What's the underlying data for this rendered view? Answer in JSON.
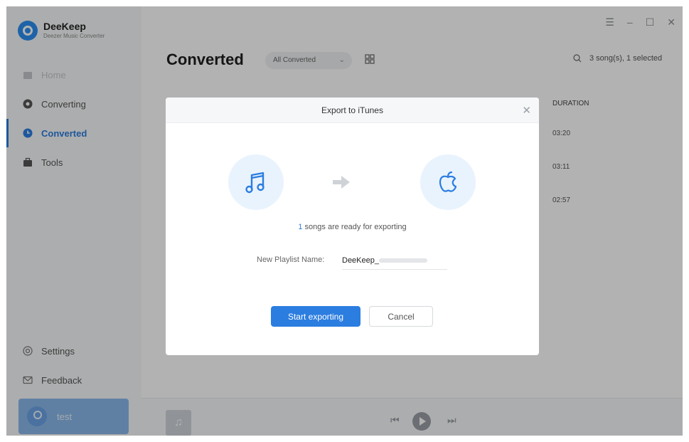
{
  "app": {
    "name": "DeeKeep",
    "subtitle": "Deezer Music Converter"
  },
  "sidebar": {
    "items": [
      {
        "label": "Home",
        "icon": "home-icon"
      },
      {
        "label": "Converting",
        "icon": "converting-icon"
      },
      {
        "label": "Converted",
        "icon": "clock-icon"
      },
      {
        "label": "Tools",
        "icon": "toolbox-icon"
      }
    ],
    "settings": "Settings",
    "feedback": "Feedback",
    "user": "test"
  },
  "window_controls": [
    "menu-icon",
    "minimize-icon",
    "maximize-icon",
    "close-icon"
  ],
  "main": {
    "title": "Converted",
    "filter": "All Converted",
    "count_text": "3 song(s), 1 selected",
    "duration_header": "DURATION",
    "durations": [
      "03:20",
      "03:11",
      "02:57"
    ]
  },
  "dialog": {
    "title": "Export to iTunes",
    "ready_count": "1",
    "ready_text": " songs are ready for exporting",
    "playlist_label": "New Playlist Name:",
    "playlist_value": "DeeKeep_",
    "start_button": "Start exporting",
    "cancel_button": "Cancel"
  },
  "colors": {
    "accent": "#2b7de0",
    "icon_bg": "#e9f3fd"
  }
}
